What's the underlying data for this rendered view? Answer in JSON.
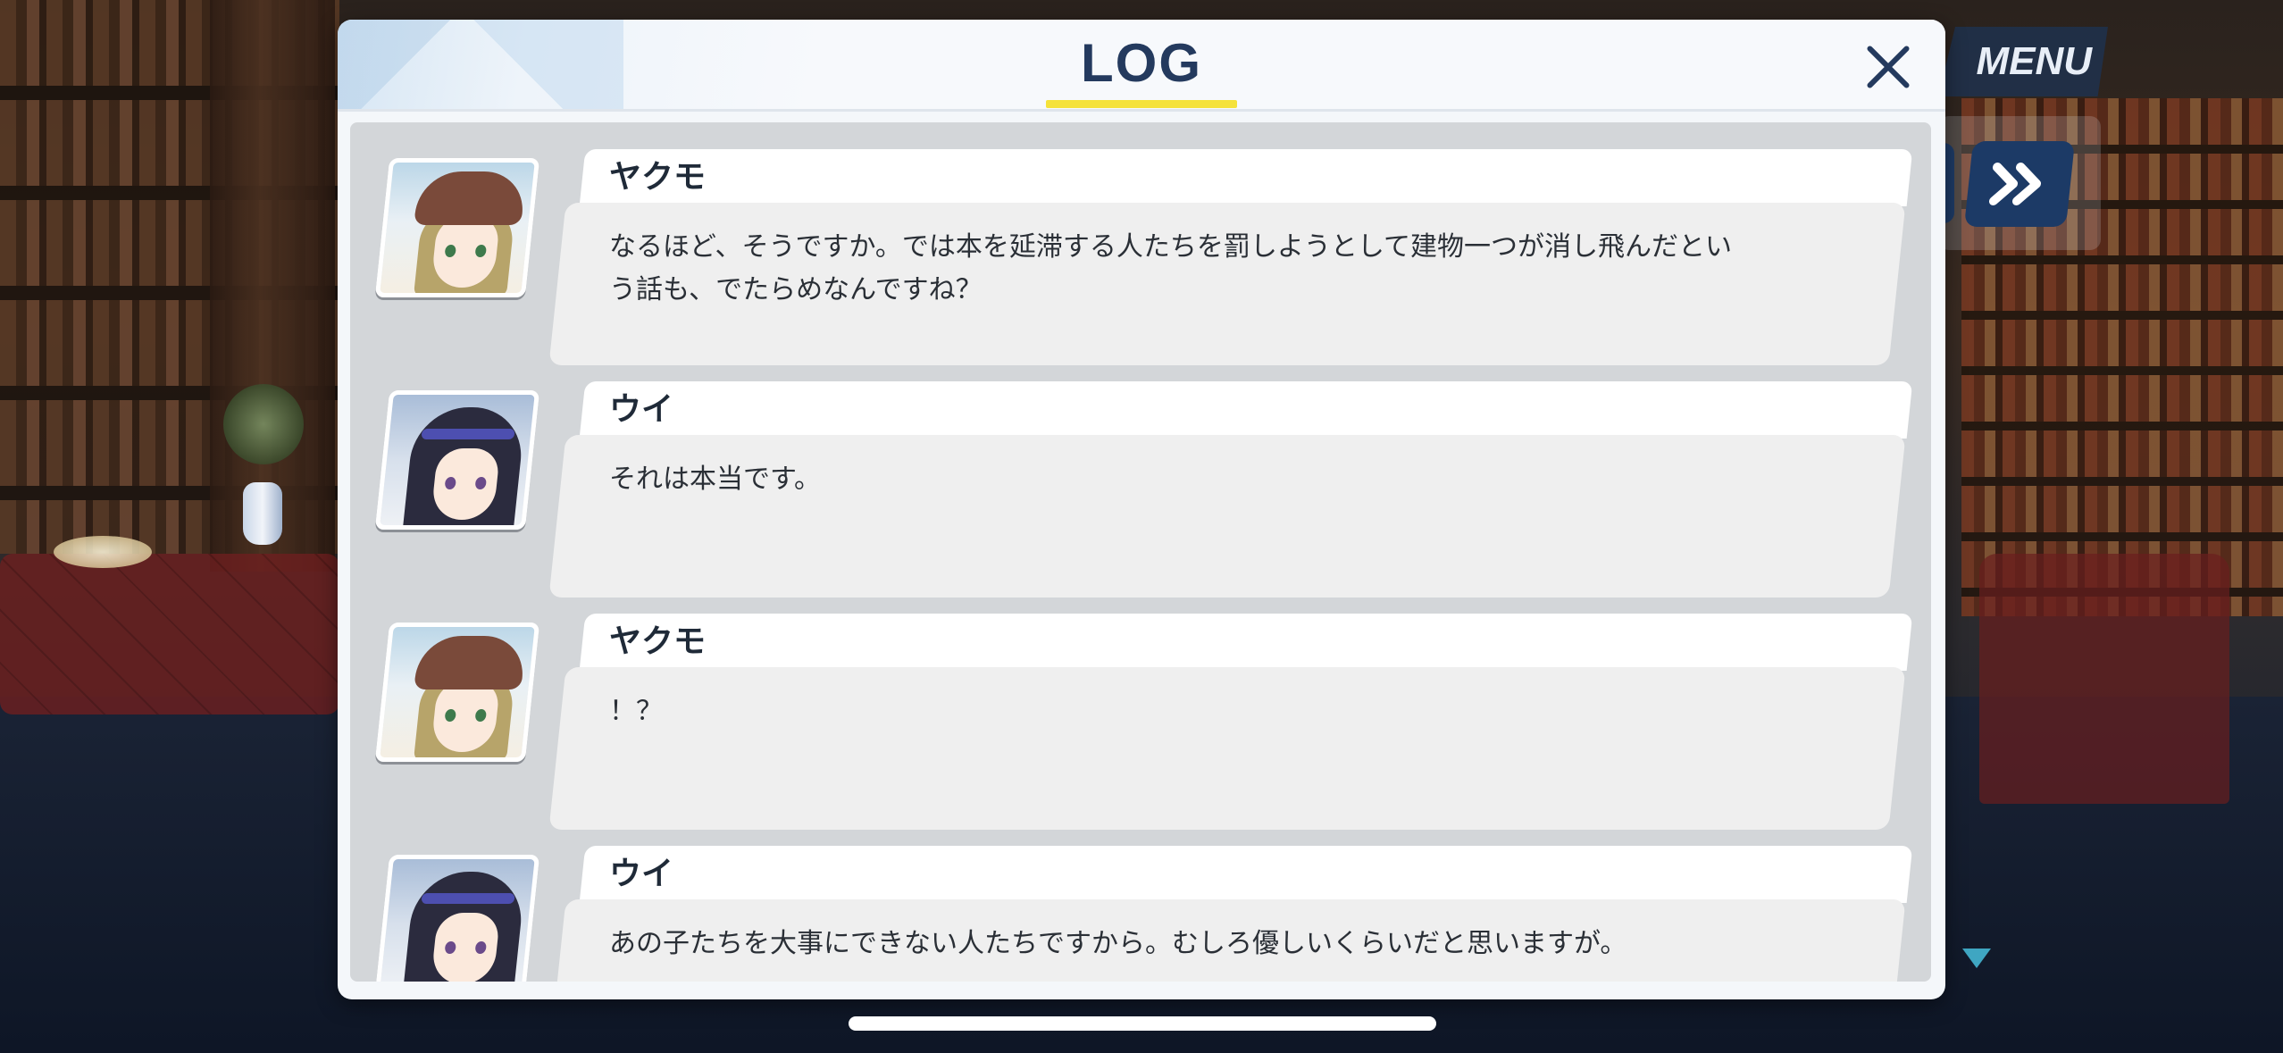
{
  "menu": {
    "label": "MENU"
  },
  "log": {
    "title": "LOG",
    "entries": [
      {
        "speaker": "ヤクモ",
        "portrait": "yakumo-portrait",
        "lines": [
          "なるほど、そうですか。では本を延滞する人たちを罰しようとして建物一つが消し飛んだとい",
          "う話も、でたらめなんですね？"
        ]
      },
      {
        "speaker": "ウイ",
        "portrait": "ui-portrait",
        "lines": [
          "それは本当です。"
        ]
      },
      {
        "speaker": "ヤクモ",
        "portrait": "yakumo-portrait",
        "lines": [
          "！？"
        ]
      },
      {
        "speaker": "ウイ",
        "portrait": "ui-portrait",
        "lines": [
          "あの子たちを大事にできない人たちですから。むしろ優しいくらいだと思いますが。"
        ]
      }
    ]
  },
  "icons": {
    "close": "close-icon",
    "skip": "fast-forward-icon",
    "scroll": "chevron-down-icon"
  },
  "colors": {
    "accent_underline": "#f5e23a",
    "title": "#243a5e",
    "button_bg": "#1c3a66"
  }
}
